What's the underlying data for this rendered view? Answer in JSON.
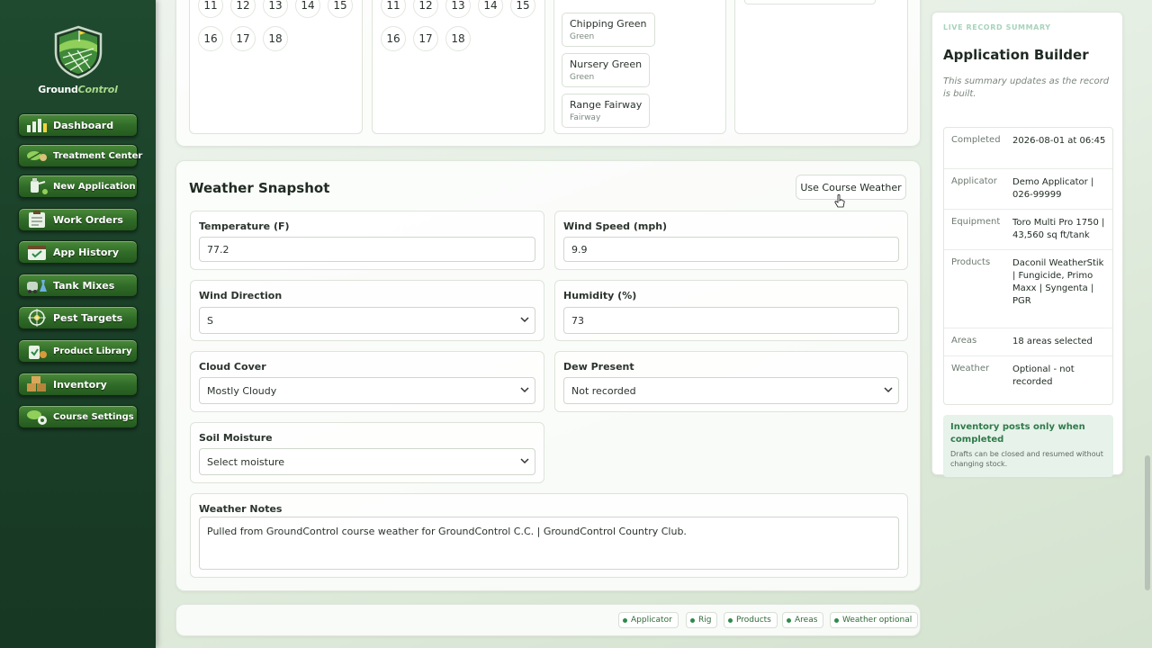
{
  "brand": {
    "name_part1": "Ground",
    "name_part2": "Control"
  },
  "nav": [
    {
      "label": "Dashboard",
      "icon": "chart-bars-icon"
    },
    {
      "label": "Treatment Center",
      "icon": "leaf-icon"
    },
    {
      "label": "New Application",
      "icon": "sprayer-icon"
    },
    {
      "label": "Work Orders",
      "icon": "clipboard-icon"
    },
    {
      "label": "App History",
      "icon": "calendar-check-icon"
    },
    {
      "label": "Tank Mixes",
      "icon": "tank-icon"
    },
    {
      "label": "Pest Targets",
      "icon": "crosshair-icon"
    },
    {
      "label": "Product Library",
      "icon": "bottle-icon"
    },
    {
      "label": "Inventory",
      "icon": "boxes-icon"
    },
    {
      "label": "Course Settings",
      "icon": "gear-icon"
    }
  ],
  "areas": {
    "col1_holes_row1": [
      "11",
      "12",
      "13",
      "14",
      "15"
    ],
    "col1_holes_row2": [
      "16",
      "17",
      "18"
    ],
    "col2_holes_row1": [
      "11",
      "12",
      "13",
      "14",
      "15"
    ],
    "col2_holes_row2": [
      "16",
      "17",
      "18"
    ],
    "chips": [
      {
        "name": "Chipping Green",
        "sub": "Green"
      },
      {
        "name": "Nursery Green",
        "sub": "Green"
      },
      {
        "name": "Range Fairway",
        "sub": "Fairway"
      }
    ]
  },
  "weather": {
    "title": "Weather Snapshot",
    "use_course_weather": "Use Course Weather",
    "temperature": {
      "label": "Temperature (F)",
      "value": "77.2"
    },
    "wind_speed": {
      "label": "Wind Speed (mph)",
      "value": "9.9"
    },
    "wind_direction": {
      "label": "Wind Direction",
      "value": "S"
    },
    "humidity": {
      "label": "Humidity (%)",
      "value": "73"
    },
    "cloud_cover": {
      "label": "Cloud Cover",
      "value": "Mostly Cloudy"
    },
    "dew_present": {
      "label": "Dew Present",
      "value": "Not recorded"
    },
    "soil_moisture": {
      "label": "Soil Moisture",
      "value": "Select moisture"
    },
    "notes": {
      "label": "Weather Notes",
      "value": "Pulled from GroundControl course weather for GroundControl C.C. | GroundControl Country Club."
    }
  },
  "footer_tags": [
    "Applicator",
    "Rig",
    "Products",
    "Areas",
    "Weather optional"
  ],
  "summary": {
    "eyebrow": "LIVE RECORD SUMMARY",
    "title": "Application Builder",
    "note": "This summary updates as the record is built.",
    "rows": [
      {
        "key": "Completed",
        "value": "2026-08-01 at 06:45"
      },
      {
        "key": "Applicator",
        "value": "Demo Applicator | 026-99999"
      },
      {
        "key": "Equipment",
        "value": "Toro Multi Pro 1750 | 43,560 sq ft/tank"
      },
      {
        "key": "Products",
        "value": "Daconil WeatherStik | Fungicide, Primo Maxx | Syngenta | PGR"
      },
      {
        "key": "Areas",
        "value": "18 areas selected"
      },
      {
        "key": "Weather",
        "value": "Optional - not recorded"
      }
    ],
    "callout_title": "Inventory posts only when completed",
    "callout_sub": "Drafts can be closed and resumed without changing stock."
  },
  "colors": {
    "sidebar": "#1f4a2f",
    "nav_button": "#2f6a27",
    "accent_green": "#2f7a4a",
    "callout_bg": "#e6f2ea"
  }
}
